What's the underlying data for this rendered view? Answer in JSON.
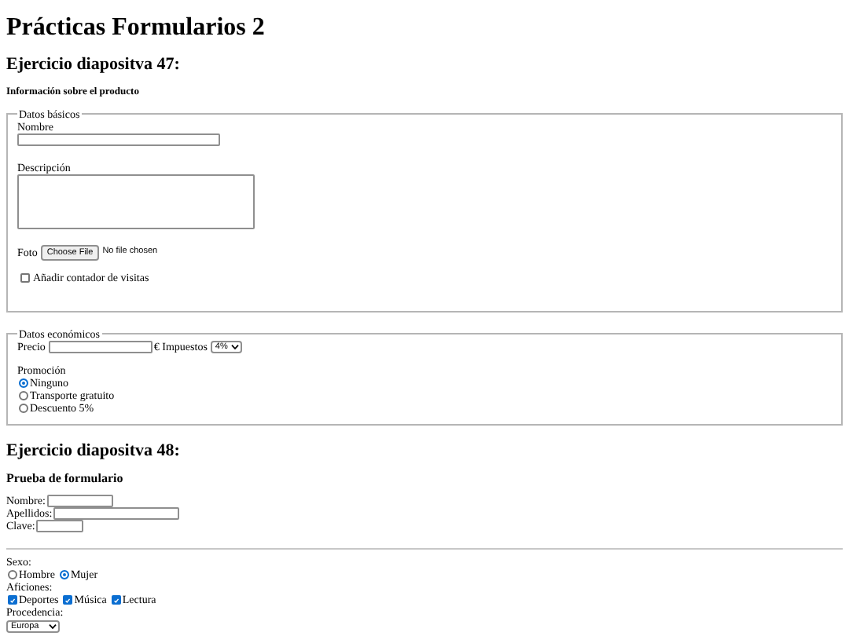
{
  "page_title": "Prácticas Formularios 2",
  "exercise_47": {
    "heading": "Ejercicio diapositva 47:",
    "subheading": "Información sobre el producto",
    "basic_fieldset": {
      "legend": "Datos básicos",
      "name_label": "Nombre",
      "description_label": "Descripción",
      "photo_label": "Foto",
      "file_button": "Choose File",
      "file_status": "No file chosen",
      "visits_checkbox": {
        "label": "Añadir contador de visitas",
        "checked": false
      }
    },
    "economic_fieldset": {
      "legend": "Datos económicos",
      "price_label": "Precio",
      "tax_label": "€ Impuestos",
      "tax_select": "4%",
      "promotion_label": "Promoción",
      "promotions": [
        {
          "label": "Ninguno",
          "selected": true
        },
        {
          "label": "Transporte gratuito",
          "selected": false
        },
        {
          "label": "Descuento 5%",
          "selected": false
        }
      ]
    }
  },
  "exercise_48": {
    "heading": "Ejercicio diapositva 48:",
    "subheading": "Prueba de formulario",
    "fields": [
      {
        "label": "Nombre:"
      },
      {
        "label": "Apellidos:"
      },
      {
        "label": "Clave:"
      }
    ],
    "sex_label": "Sexo:",
    "sexes": [
      {
        "label": "Hombre",
        "selected": false
      },
      {
        "label": "Mujer",
        "selected": true
      }
    ],
    "hobbies_label": "Aficiones:",
    "hobbies": [
      {
        "label": "Deportes",
        "checked": true
      },
      {
        "label": "Música",
        "checked": true
      },
      {
        "label": "Lectura",
        "checked": true
      }
    ],
    "origin_label": "Procedencia:",
    "origin_select": "Europa"
  }
}
